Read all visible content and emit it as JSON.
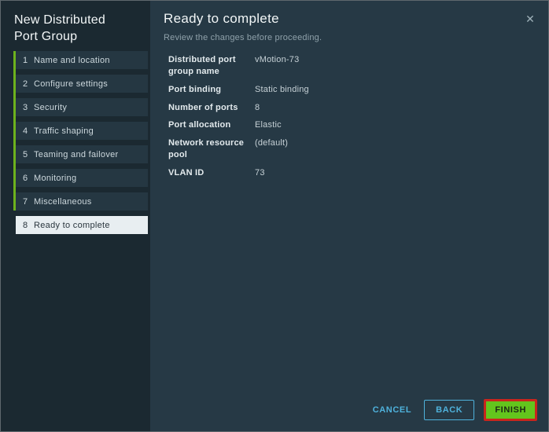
{
  "sidebar": {
    "title": "New Distributed Port Group",
    "steps": [
      {
        "number": "1",
        "label": "Name and location"
      },
      {
        "number": "2",
        "label": "Configure settings"
      },
      {
        "number": "3",
        "label": "Security"
      },
      {
        "number": "4",
        "label": "Traffic shaping"
      },
      {
        "number": "5",
        "label": "Teaming and failover"
      },
      {
        "number": "6",
        "label": "Monitoring"
      },
      {
        "number": "7",
        "label": "Miscellaneous"
      },
      {
        "number": "8",
        "label": "Ready to complete",
        "selected": true
      }
    ]
  },
  "main": {
    "heading": "Ready to complete",
    "subtitle": "Review the changes before proceeding.",
    "close_icon": "✕",
    "review_rows": [
      {
        "label": "Distributed port group name",
        "value": "vMotion-73"
      },
      {
        "label": "Port binding",
        "value": "Static binding"
      },
      {
        "label": "Number of ports",
        "value": "8"
      },
      {
        "label": "Port allocation",
        "value": "Elastic"
      },
      {
        "label": "Network resource pool",
        "value": "(default)"
      },
      {
        "label": "VLAN ID",
        "value": "73"
      }
    ]
  },
  "footer": {
    "cancel_label": "CANCEL",
    "back_label": "BACK",
    "finish_label": "FINISH"
  },
  "colors": {
    "progress_green": "#6db21d",
    "action_blue": "#4fb2dc",
    "finish_green": "#63c51d",
    "annotation_red": "#c9251d",
    "sidebar_bg": "#1b2931",
    "main_bg": "#263945",
    "selected_step_bg": "#e8eef1"
  }
}
